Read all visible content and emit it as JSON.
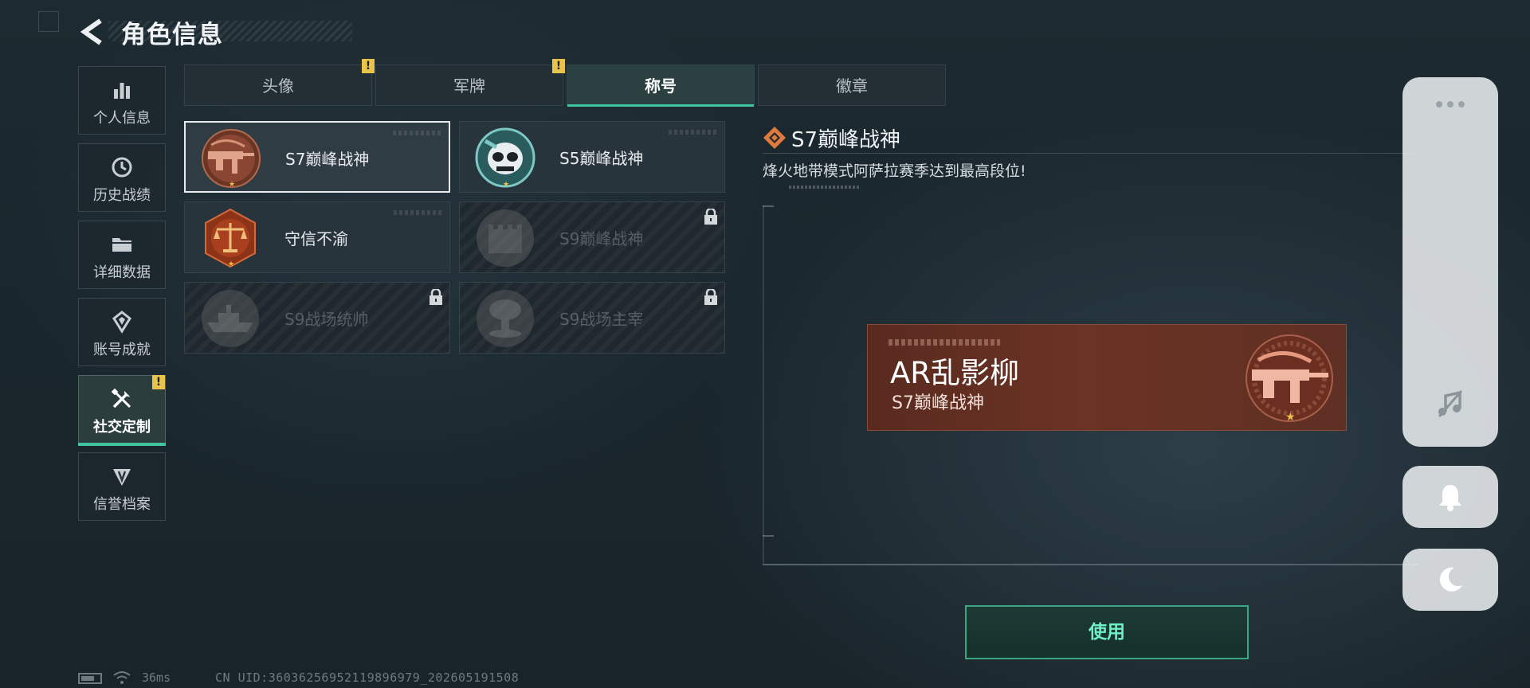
{
  "header": {
    "title": "角色信息"
  },
  "sidebar": {
    "items": [
      {
        "label": "个人信息",
        "icon": "bar-chart-icon"
      },
      {
        "label": "历史战绩",
        "icon": "history-icon"
      },
      {
        "label": "详细数据",
        "icon": "folder-icon"
      },
      {
        "label": "账号成就",
        "icon": "achievement-icon"
      },
      {
        "label": "社交定制",
        "icon": "tools-icon",
        "active": true,
        "badge": "!"
      },
      {
        "label": "信誉档案",
        "icon": "reputation-icon"
      }
    ]
  },
  "tabs": [
    {
      "label": "头像",
      "badge": "!"
    },
    {
      "label": "军牌",
      "badge": "!"
    },
    {
      "label": "称号",
      "active": true
    },
    {
      "label": "徽章"
    }
  ],
  "titles": [
    {
      "name": "S7巅峰战神",
      "selected": true,
      "locked": false
    },
    {
      "name": "S5巅峰战神",
      "selected": false,
      "locked": false
    },
    {
      "name": "守信不渝",
      "selected": false,
      "locked": false
    },
    {
      "name": "S9巅峰战神",
      "selected": false,
      "locked": true
    },
    {
      "name": "S9战场统帅",
      "selected": false,
      "locked": true
    },
    {
      "name": "S9战场主宰",
      "selected": false,
      "locked": true
    }
  ],
  "detail": {
    "title": "S7巅峰战神",
    "description": "烽火地带模式阿萨拉赛季达到最高段位!"
  },
  "nameplate": {
    "player_name": "AR乱影柳",
    "title": "S7巅峰战神"
  },
  "use_button": {
    "label": "使用"
  },
  "status": {
    "ping": "36ms",
    "uid": "CN UID:3603625695211989​6979_202605191508"
  },
  "colors": {
    "accent": "#3fc6a0",
    "badge": "#e9c44b",
    "nameplate": "#6a3324",
    "use_text": "#6ef0c4"
  }
}
